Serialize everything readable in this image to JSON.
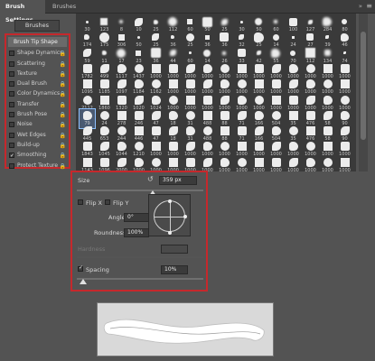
{
  "tabs": {
    "brush_settings": "Brush Settings",
    "brushes": "Brushes"
  },
  "left_panel": {
    "brushes_button": "Brushes",
    "items": [
      {
        "label": "Brush Tip Shape",
        "header": true
      },
      {
        "label": "Shape Dynamics",
        "checked": false
      },
      {
        "label": "Scattering",
        "checked": false
      },
      {
        "label": "Texture",
        "checked": false
      },
      {
        "label": "Dual Brush",
        "checked": false
      },
      {
        "label": "Color Dynamics",
        "checked": false
      },
      {
        "label": "Transfer",
        "checked": false
      },
      {
        "label": "Brush Pose",
        "checked": false
      },
      {
        "label": "Noise",
        "checked": false
      },
      {
        "label": "Wet Edges",
        "checked": false
      },
      {
        "label": "Build-up",
        "checked": false
      },
      {
        "label": "Smoothing",
        "checked": true
      },
      {
        "label": "Protect Texture",
        "checked": false
      }
    ]
  },
  "brush_grid": {
    "numbers": [
      [
        "30",
        "123",
        "8",
        "10",
        "25",
        "112",
        "60",
        "50",
        "25",
        "30",
        "50",
        "60",
        "100",
        "127",
        "284",
        "80"
      ],
      [
        "174",
        "175",
        "306",
        "50",
        "25",
        "36",
        "25",
        "36",
        "36",
        "32",
        "25",
        "14",
        "24",
        "27",
        "39",
        "46"
      ],
      [
        "59",
        "11",
        "17",
        "23",
        "36",
        "44",
        "60",
        "14",
        "26",
        "33",
        "42",
        "55",
        "70",
        "112",
        "134",
        "74"
      ],
      [
        "1782",
        "499",
        "1117",
        "1437",
        "1000",
        "1000",
        "1000",
        "1000",
        "1000",
        "1000",
        "1000",
        "1000",
        "1000",
        "1000",
        "1000",
        "1000"
      ],
      [
        "1095",
        "1185",
        "1097",
        "1184",
        "1162",
        "1000",
        "1000",
        "1000",
        "1000",
        "1000",
        "1000",
        "1000",
        "1000",
        "1000",
        "1000",
        "1000"
      ],
      [
        "2112",
        "1860",
        "1320",
        "1020",
        "1024",
        "1000",
        "1000",
        "1000",
        "1000",
        "1000",
        "1000",
        "1000",
        "1000",
        "1000",
        "1000",
        "1000"
      ],
      [
        "79",
        "24",
        "278",
        "246",
        "47",
        "18",
        "31",
        "488",
        "88",
        "71",
        "166",
        "504",
        "35",
        "476",
        "58",
        "90"
      ],
      [
        "445",
        "653",
        "244",
        "446",
        "47",
        "18",
        "31",
        "488",
        "88",
        "71",
        "166",
        "504",
        "35",
        "476",
        "58",
        "90"
      ],
      [
        "1843",
        "1045",
        "1044",
        "1210",
        "1000",
        "1000",
        "1000",
        "1000",
        "1000",
        "1000",
        "1000",
        "1000",
        "1000",
        "1000",
        "1000",
        "1000"
      ],
      [
        "1143",
        "1096",
        "2000",
        "1000",
        "1000",
        "1000",
        "1000",
        "1000",
        "1000",
        "1000",
        "1000",
        "1000",
        "1000",
        "1000",
        "1000",
        "1000"
      ]
    ]
  },
  "settings": {
    "size_label": "Size",
    "size_value": "359 px",
    "flip_x": "Flip X",
    "flip_y": "Flip Y",
    "angle_label": "Angle:",
    "angle_value": "0°",
    "roundness_label": "Roundness:",
    "roundness_value": "100%",
    "hardness_label": "Hardness",
    "spacing_label": "Spacing",
    "spacing_value": "10%",
    "spacing_checked": true,
    "size_slider_fraction": 0.6,
    "spacing_slider_fraction": 0.05
  },
  "colors": {
    "panel_bg": "#535353",
    "highlight_red": "#c6282c",
    "selection_blue": "#8ec1ff"
  }
}
